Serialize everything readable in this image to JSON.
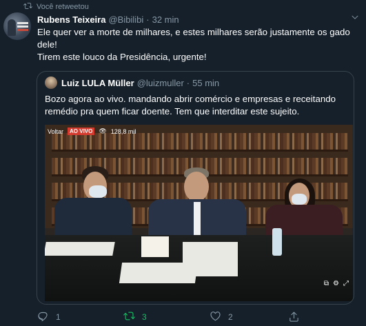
{
  "retweet_notice": "Você retweetou",
  "tweet": {
    "author_name": "Rubens Teixeira",
    "handle": "@Bibilibi",
    "separator": "·",
    "time": "32 min",
    "text_line1": "Ele quer ver a morte de milhares, e estes milhares serão justamente os gado dele!",
    "text_line2": "Tirem este louco da Presidência, urgente!"
  },
  "quoted": {
    "author_name": "Luiz LULA Müller",
    "handle": "@luizmuller",
    "separator": "·",
    "time": "55 min",
    "text": "Bozo agora ao vivo. mandando abrir comércio e empresas e receitando remédio pra quem ficar doente. Tem que interditar este sujeito."
  },
  "video": {
    "back_label": "Voltar",
    "live_badge": "AO VIVO",
    "view_count": "128,8 mil"
  },
  "actions": {
    "reply_count": "1",
    "retweet_count": "3",
    "like_count": "2"
  },
  "colors": {
    "background": "#15202b",
    "secondary_text": "#8899a6",
    "retweet_active": "#17bf63",
    "border": "#38444d",
    "live_red": "#d43a2e"
  },
  "icons": [
    "retweet-icon",
    "chevron-down-icon",
    "reply-icon",
    "like-icon",
    "share-icon",
    "eye-icon"
  ]
}
